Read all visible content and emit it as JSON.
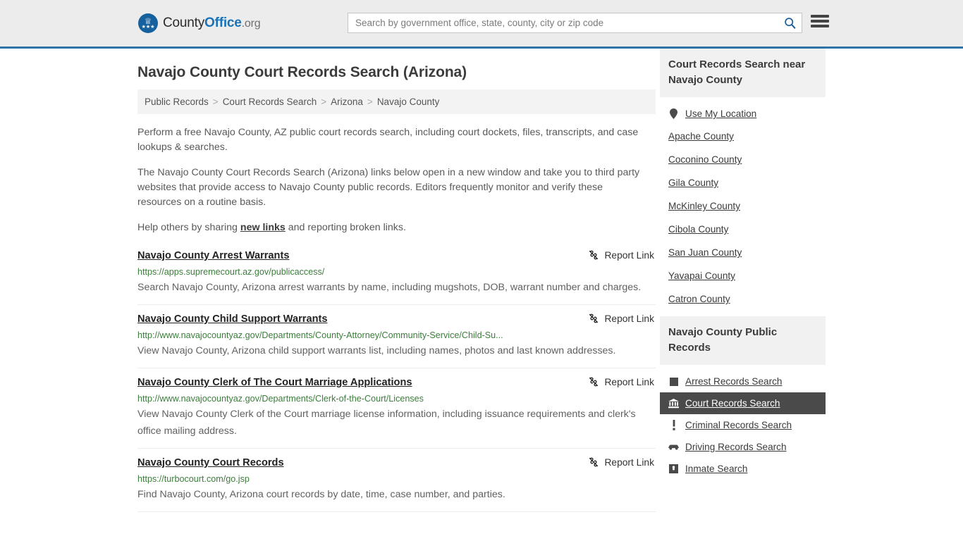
{
  "header": {
    "brand": {
      "part1": "County",
      "part2": "Office",
      "part3": ".org"
    },
    "search": {
      "placeholder": "Search by government office, state, county, city or zip code",
      "value": "",
      "search_icon": "search-icon"
    },
    "menu_icon": "hamburger-menu-icon"
  },
  "page": {
    "title": "Navajo County Court Records Search (Arizona)",
    "breadcrumb": [
      "Public Records",
      "Court Records Search",
      "Arizona",
      "Navajo County"
    ],
    "breadcrumb_separator": ">",
    "intro": [
      "Perform a free Navajo County, AZ public court records search, including court dockets, files, transcripts, and case lookups & searches.",
      "The Navajo County Court Records Search (Arizona) links below open in a new window and take you to third party websites that provide access to Navajo County public records. Editors frequently monitor and verify these resources on a routine basis."
    ],
    "help_prefix": "Help others by sharing ",
    "help_link": "new links",
    "help_suffix": " and reporting broken links."
  },
  "results": {
    "report_label": "Report Link",
    "report_icon": "broken-link-icon",
    "items": [
      {
        "title": "Navajo County Arrest Warrants",
        "url": "https://apps.supremecourt.az.gov/publicaccess/",
        "description": "Search Navajo County, Arizona arrest warrants by name, including mugshots, DOB, warrant number and charges."
      },
      {
        "title": "Navajo County Child Support Warrants",
        "url": "http://www.navajocountyaz.gov/Departments/County-Attorney/Community-Service/Child-Su...",
        "description": "View Navajo County, Arizona child support warrants list, including names, photos and last known addresses."
      },
      {
        "title": "Navajo County Clerk of The Court Marriage Applications",
        "url": "http://www.navajocountyaz.gov/Departments/Clerk-of-the-Court/Licenses",
        "description": "View Navajo County Clerk of the Court marriage license information, including issuance requirements and clerk's office mailing address."
      },
      {
        "title": "Navajo County Court Records",
        "url": "https://turbocourt.com/go.jsp",
        "description": "Find Navajo County, Arizona court records by date, time, case number, and parties."
      }
    ]
  },
  "sidebar": {
    "nearby": {
      "heading": "Court Records Search near Navajo County",
      "use_location": {
        "label": "Use My Location",
        "icon": "map-pin-icon"
      },
      "counties": [
        "Apache County",
        "Coconino County",
        "Gila County",
        "McKinley County",
        "Cibola County",
        "San Juan County",
        "Yavapai County",
        "Catron County"
      ]
    },
    "public_records": {
      "heading": "Navajo County Public Records",
      "items": [
        {
          "label": "Arrest Records Search",
          "icon": "fingerprint-icon",
          "active": false
        },
        {
          "label": "Court Records Search",
          "icon": "courthouse-icon",
          "active": true
        },
        {
          "label": "Criminal Records Search",
          "icon": "exclamation-icon",
          "active": false
        },
        {
          "label": "Driving Records Search",
          "icon": "car-icon",
          "active": false
        },
        {
          "label": "Inmate Search",
          "icon": "jail-icon",
          "active": false
        }
      ]
    }
  },
  "colors": {
    "header_bg": "#ececec",
    "header_border": "#2e74a8",
    "brand_blue": "#1a73b8",
    "url_green": "#3c7d3c",
    "active_bg": "#4a4a4a",
    "panel_bg": "#f1f1f1"
  }
}
